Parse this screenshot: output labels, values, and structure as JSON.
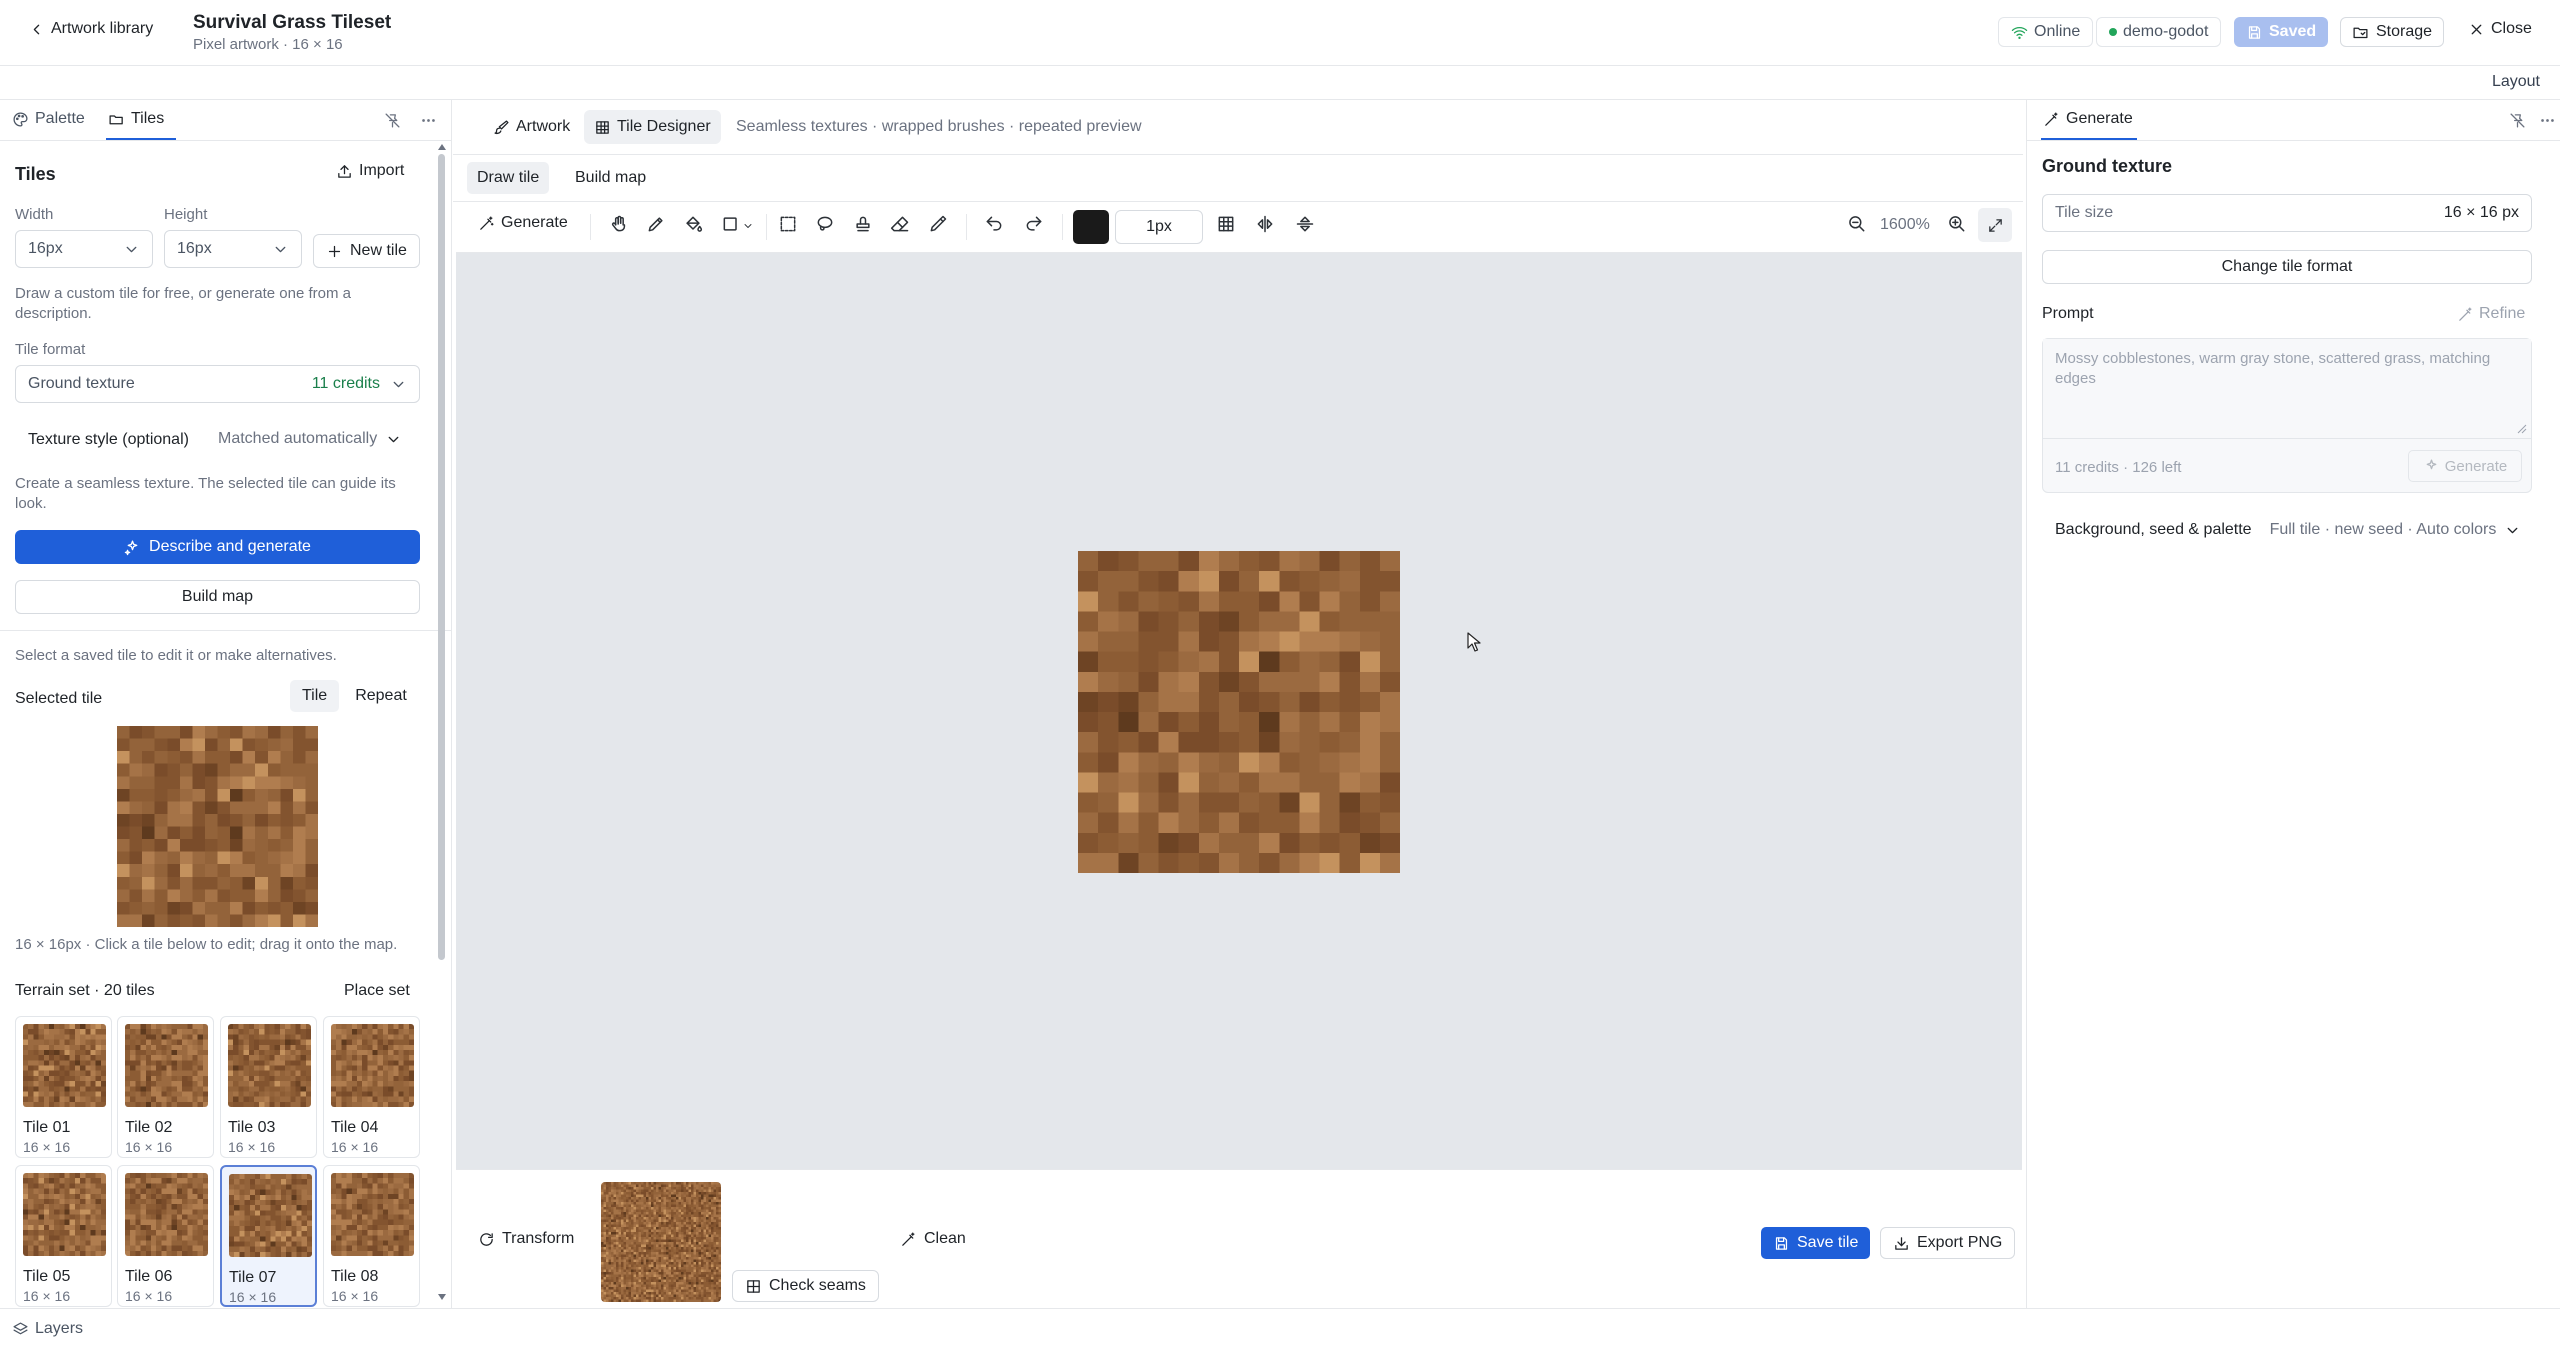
{
  "header": {
    "back_label": "Artwork library",
    "title": "Survival Grass Tileset",
    "subtitle": "Pixel artwork · 16 × 16",
    "online_label": "Online",
    "project_label": "demo-godot",
    "saved_label": "Saved",
    "storage_label": "Storage",
    "close_label": "Close",
    "layout_label": "Layout"
  },
  "left": {
    "tabs": [
      "Palette",
      "Tiles"
    ],
    "section_title": "Tiles",
    "import_label": "Import",
    "width_label": "Width",
    "height_label": "Height",
    "width_value": "16px",
    "height_value": "16px",
    "new_tile_label": "New tile",
    "draw_hint": "Draw a custom tile for free, or generate one from a description.",
    "tile_format_label": "Tile format",
    "tile_format_value": "Ground texture",
    "tile_format_credits": "11 credits",
    "texture_style_label": "Texture style (optional)",
    "texture_style_value": "Matched automatically",
    "seamless_hint": "Create a seamless texture. The selected tile can guide its look.",
    "describe_button": "Describe and generate",
    "build_map_button": "Build map",
    "select_hint": "Select a saved tile to edit it or make alternatives.",
    "selected_tile_label": "Selected tile",
    "view_tile": "Tile",
    "view_repeat": "Repeat",
    "selected_hint": "16 × 16px · Click a tile below to edit; drag it onto the map.",
    "terrain_set_label": "Terrain set · 20 tiles",
    "place_set_label": "Place set",
    "tiles": [
      {
        "name": "Tile 01",
        "size": "16 × 16"
      },
      {
        "name": "Tile 02",
        "size": "16 × 16"
      },
      {
        "name": "Tile 03",
        "size": "16 × 16"
      },
      {
        "name": "Tile 04",
        "size": "16 × 16"
      },
      {
        "name": "Tile 05",
        "size": "16 × 16"
      },
      {
        "name": "Tile 06",
        "size": "16 × 16"
      },
      {
        "name": "Tile 07",
        "size": "16 × 16"
      },
      {
        "name": "Tile 08",
        "size": "16 × 16"
      }
    ],
    "selected_tile_index": 6
  },
  "center": {
    "tab_artwork": "Artwork",
    "tab_tile_designer": "Tile Designer",
    "designer_hint": "Seamless textures · wrapped brushes · repeated preview",
    "mode_draw": "Draw tile",
    "mode_build": "Build map",
    "generate_label": "Generate",
    "brush_size": "1px",
    "zoom_label": "1600%",
    "transform_label": "Transform",
    "clean_label": "Clean",
    "check_seams_label": "Check seams",
    "save_tile_label": "Save tile",
    "export_label": "Export PNG",
    "current_color": "#1a1a1a"
  },
  "right": {
    "tab_label": "Generate",
    "section_title": "Ground texture",
    "tile_size_label": "Tile size",
    "tile_size_value": "16 × 16 px",
    "change_format_label": "Change tile format",
    "prompt_label": "Prompt",
    "refine_label": "Refine",
    "prompt_placeholder": "Mossy cobblestones, warm gray stone, scattered grass, matching edges",
    "credits_text": "11 credits · 126 left",
    "generate_label": "Generate",
    "bg_label": "Background, seed & palette",
    "bg_value": "Full tile · new seed · Auto colors"
  },
  "status": {
    "layers_label": "Layers"
  },
  "colors": {
    "accent": "#1f5fd9",
    "online": "#22a55a",
    "credits": "#1a7f4b",
    "saved_bg": "#a9bfef",
    "canvas_bg": "#e4e7eb"
  }
}
